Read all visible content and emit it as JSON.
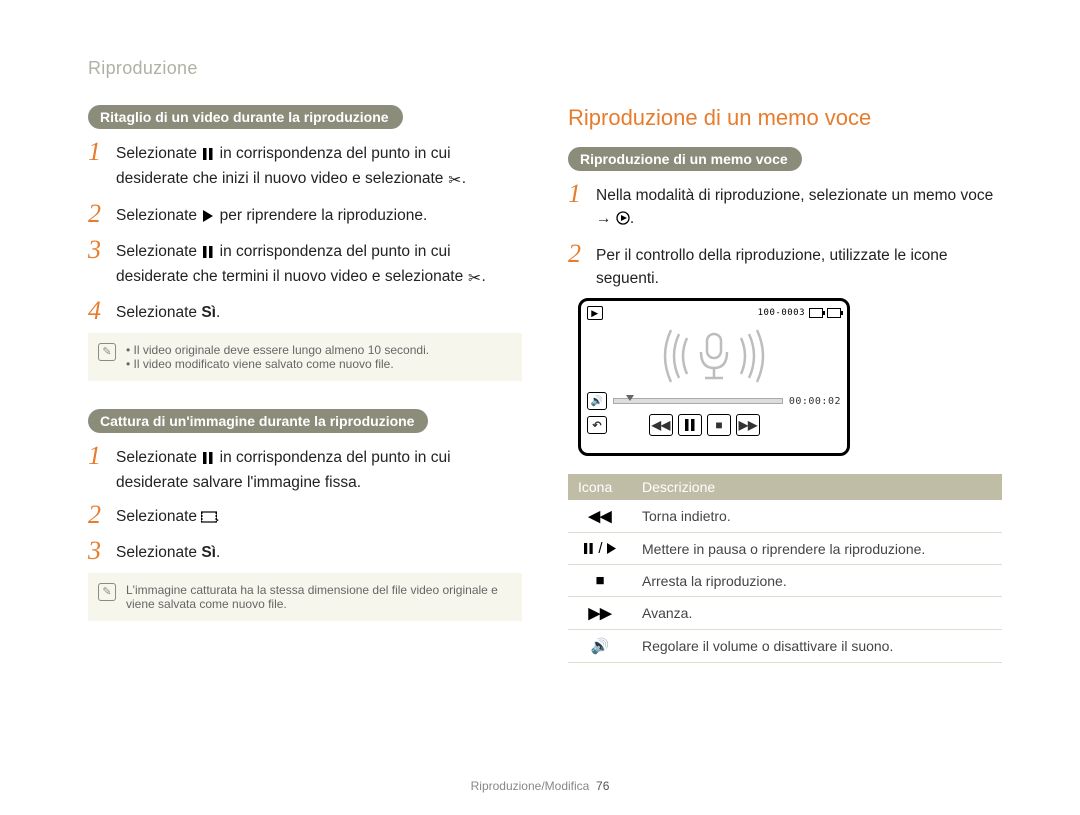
{
  "header": "Riproduzione",
  "left": {
    "pill1": "Ritaglio di un video durante la riproduzione",
    "s1a": "Selezionate ",
    "s1b": " in corrispondenza del punto in cui desiderate che inizi il nuovo video e selezionate ",
    "s2a": "Selezionate ",
    "s2b": " per riprendere la riproduzione.",
    "s3a": "Selezionate ",
    "s3b": " in corrispondenza del punto in cui desiderate che termini il nuovo video e selezionate ",
    "s4a": "Selezionate ",
    "s4b": "Sì",
    "note1a": "Il video originale deve essere lungo almeno 10 secondi.",
    "note1b": "Il video modificato viene salvato come nuovo file.",
    "pill2": "Cattura di un'immagine durante la riproduzione",
    "c1a": "Selezionate ",
    "c1b": " in corrispondenza del punto in cui desiderate salvare l'immagine fissa.",
    "c2a": "Selezionate ",
    "c3a": "Selezionate ",
    "c3b": "Sì",
    "note2": "L'immagine catturata ha la stessa dimensione del file video originale e viene salvata come nuovo file."
  },
  "right": {
    "title": "Riproduzione di un memo voce",
    "pill": "Riproduzione di un memo voce",
    "r1a": "Nella modalità di riproduzione, selezionate un memo voce → ",
    "r2": "Per il controllo della riproduzione, utilizzate le icone seguenti.",
    "player": {
      "file": "100-0003",
      "time": "00:00:02"
    },
    "table": {
      "h1": "Icona",
      "h2": "Descrizione",
      "rows": [
        {
          "desc": "Torna indietro."
        },
        {
          "desc": "Mettere in pausa o riprendere la riproduzione."
        },
        {
          "desc": "Arresta la riproduzione."
        },
        {
          "desc": "Avanza."
        },
        {
          "desc": "Regolare il volume o disattivare il suono."
        }
      ]
    }
  },
  "footer": {
    "section": "Riproduzione/Modifica",
    "page": "76"
  }
}
